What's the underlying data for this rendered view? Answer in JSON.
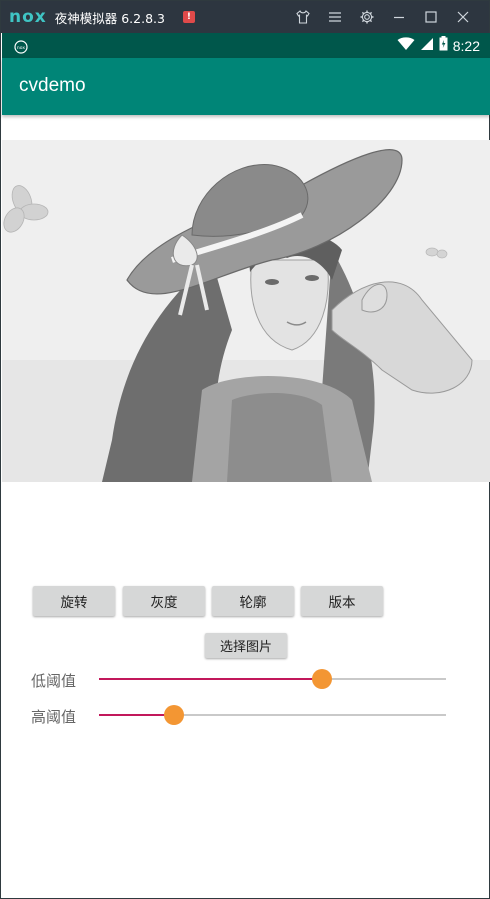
{
  "emulator": {
    "logo": "nox",
    "title": "夜神模拟器 6.2.8.3",
    "warning": "!",
    "tools": [
      "shirt-icon",
      "menu-icon",
      "gear-icon",
      "minimize-icon",
      "maximize-icon",
      "close-icon"
    ]
  },
  "statusbar": {
    "time": "8:22",
    "icons": [
      "wifi-icon",
      "signal-icon",
      "battery-icon"
    ]
  },
  "app": {
    "title": "cvdemo"
  },
  "buttons": {
    "rotate": "旋转",
    "gray": "灰度",
    "contour": "轮廓",
    "version": "版本",
    "choose": "选择图片"
  },
  "sliders": [
    {
      "label": "低阈值",
      "value_fraction": 0.643
    },
    {
      "label": "高阈值",
      "value_fraction": 0.215
    }
  ],
  "colors": {
    "appbar": "#008577",
    "statusbar": "#00574b",
    "slider_fill": "#c2185b",
    "slider_thumb": "#f39633"
  }
}
